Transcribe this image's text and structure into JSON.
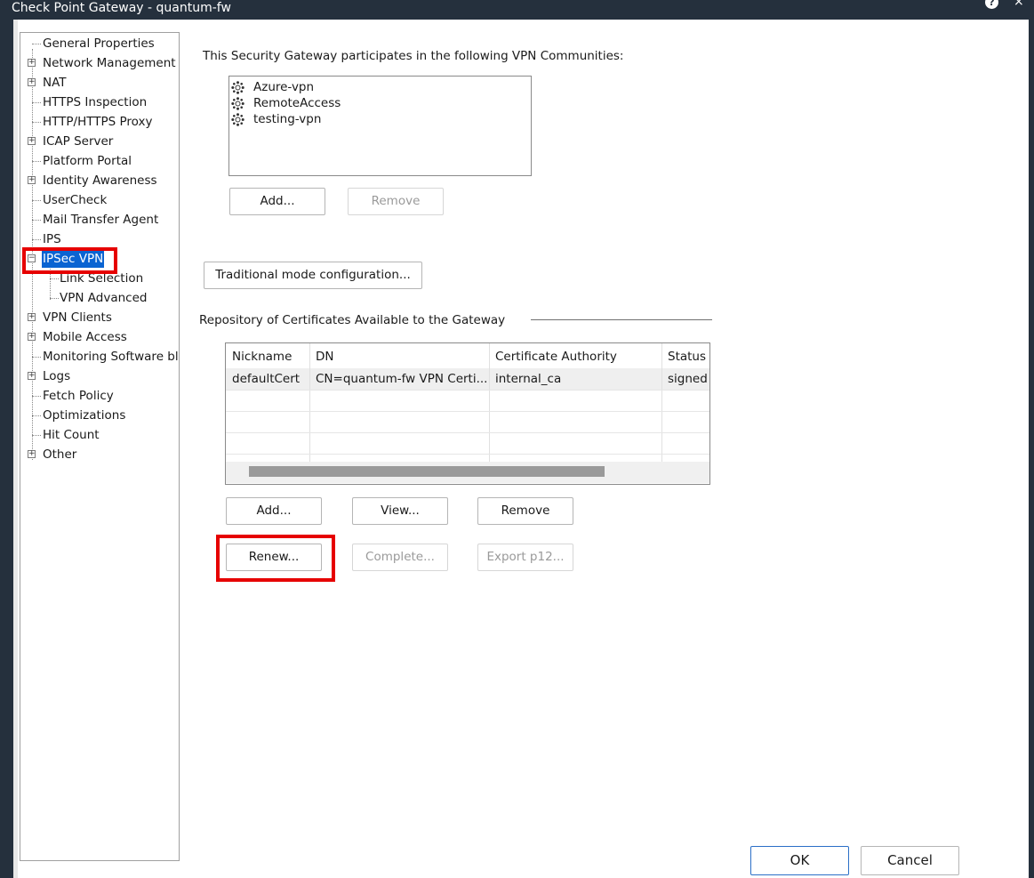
{
  "window": {
    "title": "Check Point Gateway - quantum-fw",
    "help_glyph": "?",
    "close_glyph": "×"
  },
  "tree": {
    "items": [
      {
        "label": "General Properties",
        "expandable": false
      },
      {
        "label": "Network Management",
        "expandable": true
      },
      {
        "label": "NAT",
        "expandable": true
      },
      {
        "label": "HTTPS Inspection",
        "expandable": false
      },
      {
        "label": "HTTP/HTTPS Proxy",
        "expandable": false
      },
      {
        "label": "ICAP Server",
        "expandable": true
      },
      {
        "label": "Platform Portal",
        "expandable": false
      },
      {
        "label": "Identity Awareness",
        "expandable": true
      },
      {
        "label": "UserCheck",
        "expandable": false
      },
      {
        "label": "Mail Transfer Agent",
        "expandable": false
      },
      {
        "label": "IPS",
        "expandable": false
      },
      {
        "label": "IPSec VPN",
        "expandable": true,
        "expanded": true,
        "selected": true
      },
      {
        "label": "Link Selection",
        "child": true
      },
      {
        "label": "VPN Advanced",
        "child": true
      },
      {
        "label": "VPN Clients",
        "expandable": true
      },
      {
        "label": "Mobile Access",
        "expandable": true
      },
      {
        "label": "Monitoring Software blac",
        "expandable": false
      },
      {
        "label": "Logs",
        "expandable": true
      },
      {
        "label": "Fetch Policy",
        "expandable": false
      },
      {
        "label": "Optimizations",
        "expandable": false
      },
      {
        "label": "Hit Count",
        "expandable": false
      },
      {
        "label": "Other",
        "expandable": true
      }
    ]
  },
  "communities": {
    "heading": "This Security Gateway participates in the following VPN Communities:",
    "items": [
      "Azure-vpn",
      "RemoteAccess",
      "testing-vpn"
    ],
    "add_label": "Add...",
    "remove_label": "Remove"
  },
  "traditional_mode_label": "Traditional mode configuration...",
  "certificates": {
    "heading": "Repository of Certificates Available to the Gateway",
    "columns": [
      "Nickname",
      "DN",
      "Certificate Authority",
      "Status"
    ],
    "rows": [
      [
        "defaultCert",
        "CN=quantum-fw VPN Certi...",
        "internal_ca",
        "signed"
      ]
    ],
    "add_label": "Add...",
    "view_label": "View...",
    "remove_label": "Remove",
    "renew_label": "Renew...",
    "complete_label": "Complete...",
    "export_label": "Export p12..."
  },
  "footer": {
    "ok_label": "OK",
    "cancel_label": "Cancel"
  },
  "colors": {
    "selection": "#0a64d2",
    "highlight_box": "#e60000",
    "titlebar": "#25303d"
  }
}
